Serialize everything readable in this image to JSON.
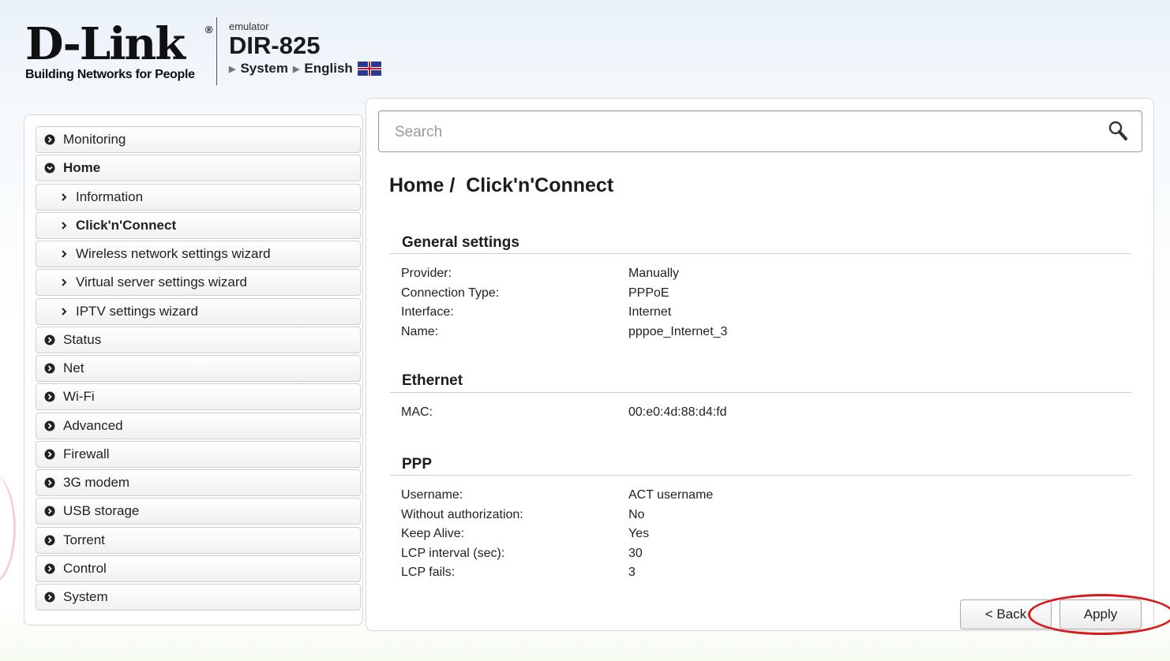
{
  "header": {
    "logo_text": "D-Link",
    "logo_reg": "®",
    "tagline": "Building Networks for People",
    "emulator": "emulator",
    "model": "DIR-825",
    "crumb_system": "System",
    "crumb_language": "English",
    "flag_icon": "uk-flag-icon"
  },
  "sidebar": {
    "items": [
      {
        "label": "Monitoring",
        "icon": "chevron-right-circle-icon"
      },
      {
        "label": "Home",
        "icon": "chevron-down-circle-icon"
      },
      {
        "label": "Information",
        "icon": "chevron-right-icon"
      },
      {
        "label": "Click'n'Connect",
        "icon": "chevron-right-icon"
      },
      {
        "label": "Wireless network settings wizard",
        "icon": "chevron-right-icon"
      },
      {
        "label": "Virtual server settings wizard",
        "icon": "chevron-right-icon"
      },
      {
        "label": "IPTV settings wizard",
        "icon": "chevron-right-icon"
      },
      {
        "label": "Status",
        "icon": "chevron-right-circle-icon"
      },
      {
        "label": "Net",
        "icon": "chevron-right-circle-icon"
      },
      {
        "label": "Wi-Fi",
        "icon": "chevron-right-circle-icon"
      },
      {
        "label": "Advanced",
        "icon": "chevron-right-circle-icon"
      },
      {
        "label": "Firewall",
        "icon": "chevron-right-circle-icon"
      },
      {
        "label": "3G modem",
        "icon": "chevron-right-circle-icon"
      },
      {
        "label": "USB storage",
        "icon": "chevron-right-circle-icon"
      },
      {
        "label": "Torrent",
        "icon": "chevron-right-circle-icon"
      },
      {
        "label": "Control",
        "icon": "chevron-right-circle-icon"
      },
      {
        "label": "System",
        "icon": "chevron-right-circle-icon"
      }
    ]
  },
  "search": {
    "placeholder": "Search",
    "icon": "search-icon"
  },
  "main": {
    "title": "Home /  Click'n'Connect",
    "general": {
      "title": "General settings",
      "rows": [
        {
          "label": "Provider:",
          "value": "Manually"
        },
        {
          "label": "Connection Type:",
          "value": "PPPoE"
        },
        {
          "label": "Interface:",
          "value": "Internet"
        },
        {
          "label": "Name:",
          "value": "pppoe_Internet_3"
        }
      ]
    },
    "ethernet": {
      "title": "Ethernet",
      "rows": [
        {
          "label": "MAC:",
          "value": "00:e0:4d:88:d4:fd"
        }
      ]
    },
    "ppp": {
      "title": "PPP",
      "rows": [
        {
          "label": "Username:",
          "value": "ACT username"
        },
        {
          "label": "Without authorization:",
          "value": "No"
        },
        {
          "label": "Keep Alive:",
          "value": "Yes"
        },
        {
          "label": "LCP interval (sec):",
          "value": "30"
        },
        {
          "label": "LCP fails:",
          "value": "3"
        }
      ]
    }
  },
  "buttons": {
    "back": "< Back",
    "apply": "Apply"
  },
  "colors": {
    "highlight_ellipse": "#d91a1a",
    "border": "#d6d6d6"
  }
}
